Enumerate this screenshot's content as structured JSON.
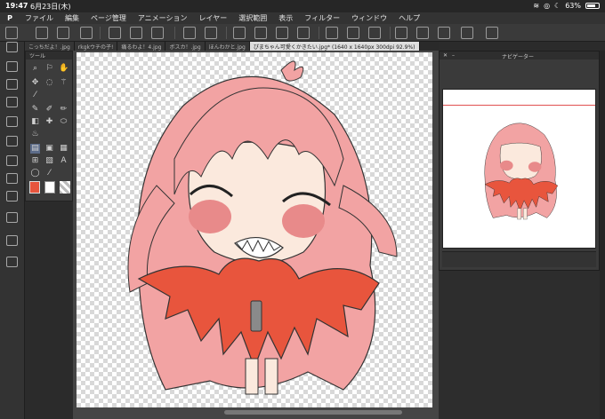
{
  "status": {
    "time": "19:47",
    "date": "6月23日(木)",
    "battery": "63%"
  },
  "menu": {
    "logo": "P",
    "items": [
      "ファイル",
      "編集",
      "ページ管理",
      "アニメーション",
      "レイヤー",
      "選択範囲",
      "表示",
      "フィルター",
      "ウィンドウ",
      "ヘルプ"
    ]
  },
  "tabs": [
    "こっちだよ！.jpg",
    "rkgkウチの子!",
    "痛るわよ！4.jpg",
    "ボスカ！.jpg",
    "ほんわかと.jpg",
    "ぴまちゃん可愛くかきたい.jpg* (1640 x 1640px 300dpi 92.9%)"
  ],
  "tool_panel": {
    "title": "ツール"
  },
  "navigator": {
    "title": "ナビゲーター"
  },
  "colors": {
    "main": "#e8553d",
    "hair": "#f2a3a3",
    "skin": "#fbe9dd",
    "accent": "#5c6c8a"
  }
}
